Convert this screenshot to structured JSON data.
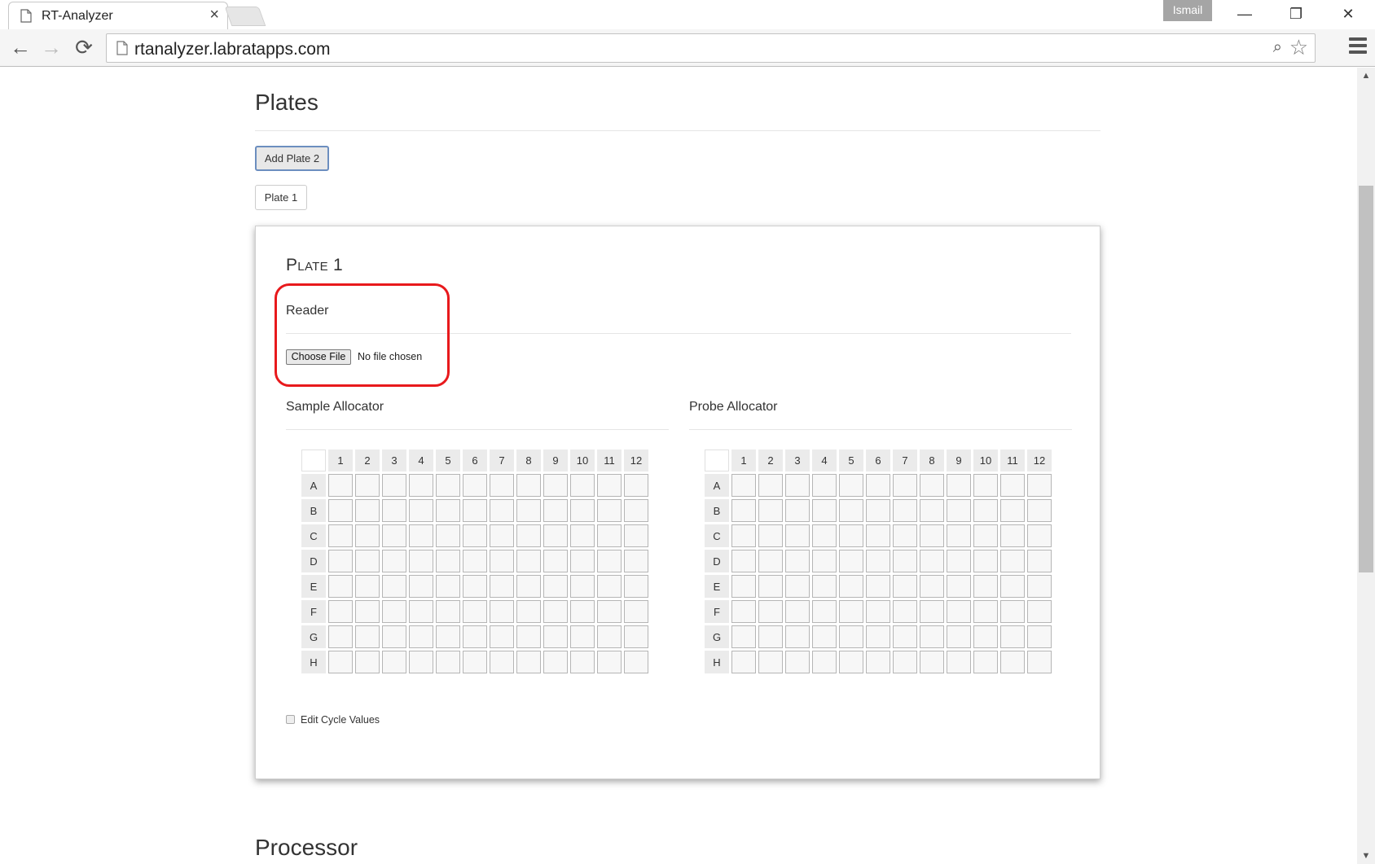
{
  "browser": {
    "tab_title": "RT-Analyzer",
    "tab_close": "×",
    "profile_name": "Ismail",
    "url": "rtanalyzer.labratapps.com",
    "window_minimize": "—",
    "window_restore": "❐",
    "window_close": "✕",
    "back_glyph": "←",
    "forward_glyph": "→",
    "reload_glyph": "⟳",
    "zoom_glyph": "⌕",
    "star_glyph": "☆"
  },
  "page": {
    "plates_heading": "Plates",
    "add_plate_button": "Add Plate 2",
    "plate_tabs": [
      "Plate 1"
    ],
    "panel": {
      "title": "Plate 1",
      "reader": {
        "title": "Reader",
        "choose_file_label": "Choose File",
        "file_status": "No file chosen"
      },
      "sample_allocator": {
        "title": "Sample Allocator",
        "columns": [
          "1",
          "2",
          "3",
          "4",
          "5",
          "6",
          "7",
          "8",
          "9",
          "10",
          "11",
          "12"
        ],
        "rows": [
          "A",
          "B",
          "C",
          "D",
          "E",
          "F",
          "G",
          "H"
        ]
      },
      "probe_allocator": {
        "title": "Probe Allocator",
        "columns": [
          "1",
          "2",
          "3",
          "4",
          "5",
          "6",
          "7",
          "8",
          "9",
          "10",
          "11",
          "12"
        ],
        "rows": [
          "A",
          "B",
          "C",
          "D",
          "E",
          "F",
          "G",
          "H"
        ]
      },
      "edit_cycle_label": "Edit Cycle Values",
      "edit_cycle_checked": false
    },
    "processor_heading": "Processor"
  },
  "colors": {
    "highlight": "#e8191c",
    "button_focus_border": "#6c8ebf"
  }
}
